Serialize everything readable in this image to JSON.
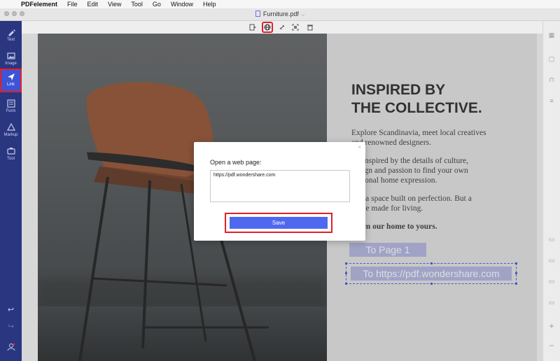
{
  "menubar": {
    "app": "PDFelement",
    "items": [
      "File",
      "Edit",
      "View",
      "Tool",
      "Go",
      "Window",
      "Help"
    ]
  },
  "window": {
    "title": "Furniture.pdf"
  },
  "sidebar": {
    "items": [
      {
        "label": "Text",
        "icon": "text-edit-icon"
      },
      {
        "label": "Image",
        "icon": "image-icon"
      },
      {
        "label": "Link",
        "icon": "link-arrow-icon",
        "active": true
      },
      {
        "label": "Form",
        "icon": "form-icon"
      },
      {
        "label": "Markup",
        "icon": "markup-icon"
      },
      {
        "label": "Tool",
        "icon": "tool-icon"
      }
    ]
  },
  "document": {
    "heading_line1": "INSPIRED BY",
    "heading_line2": "THE COLLECTIVE.",
    "para1_line1": "Explore Scandinavia, meet local creatives",
    "para1_line2": "and renowned designers.",
    "para2_line1": "Be inspired by the details of culture,",
    "para2_line2": "design and passion to find your own",
    "para2_line3": "personal home expression.",
    "para3_line1": "Not a space built on perfection. But a",
    "para3_line2": "home made for living.",
    "para4": "From our home to yours.",
    "link1": "To Page 1",
    "link2": "To https://pdf.wondershare.com"
  },
  "dialog": {
    "label": "Open a web page:",
    "url_value": "https://pdf.wondershare.com",
    "save_label": "Save",
    "close": "×"
  },
  "colors": {
    "sidebar_bg": "#2a3680",
    "active_item": "#3e54d6",
    "highlight_red": "#e0202a",
    "save_button": "#4f68f0",
    "link_box": "#a9acd6"
  }
}
